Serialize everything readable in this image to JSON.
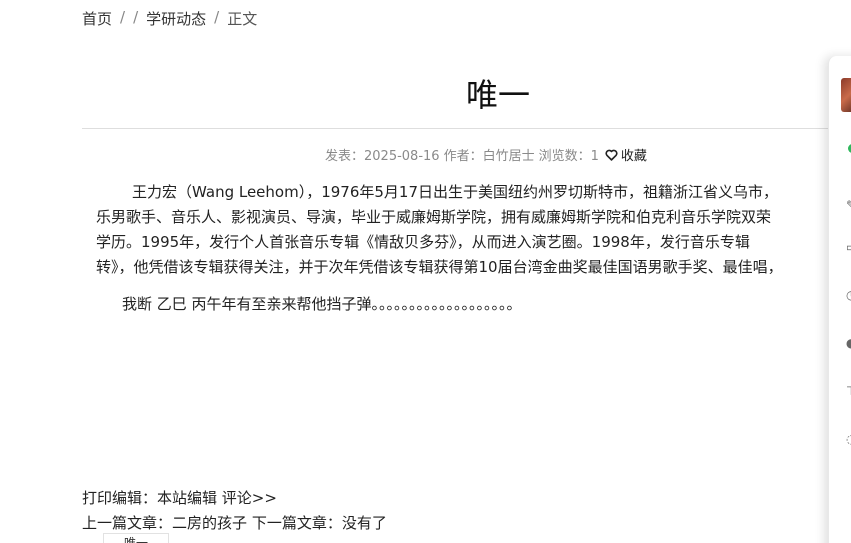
{
  "breadcrumb": {
    "home": "首页",
    "sep1": "/",
    "sep2": "/",
    "section": "学研动态",
    "sep3": "/",
    "current": "正文"
  },
  "article": {
    "title": "唯一",
    "meta": {
      "published": "发表：2025-08-16",
      "author": "作者：白竹居士",
      "views": "浏览数：1",
      "favorite": "收藏"
    },
    "paragraph1_lines": [
      "王力宏（Wang Leehom），1976年5月17日出生于美国纽约州罗切斯特市，祖籍浙江省义乌市，",
      "乐男歌手、音乐人、影视演员、导演，毕业于威廉姆斯学院，拥有威廉姆斯学院和伯克利音乐学院双荣",
      "学历。1995年，发行个人首张音乐专辑《情敌贝多芬》，从而进入演艺圈。1998年，发行音乐专辑",
      "转》，他凭借该专辑获得关注，并于次年凭借该专辑获得第10届台湾金曲奖最佳国语男歌手奖、最佳唱，"
    ],
    "paragraph2": "我断 乙巳 丙午年有至亲来帮他挡子弹。。。。。。。。。。。。。。。。。。。"
  },
  "footer": {
    "print_label": "打印编辑：本站编辑",
    "comment_link": "评论>>",
    "prev_label": "上一篇文章：",
    "prev_title": "二房的孩子",
    "next_label": "下一篇文章：",
    "next_title": "没有了",
    "thumb_text": "唯一"
  },
  "colors": {
    "status_online": "#2fb85d",
    "meta_text": "#8a8a8a"
  }
}
